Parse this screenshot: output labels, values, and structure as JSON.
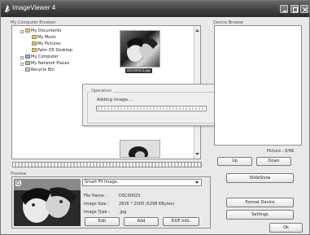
{
  "window": {
    "title": "ImageViewer 4"
  },
  "computer_browser": {
    "label": "My Computer Browser",
    "tree": [
      {
        "label": "My Documents",
        "icon": "folder-open-icon",
        "level": 0,
        "expand": "minus"
      },
      {
        "label": "My Music",
        "icon": "music-folder-icon",
        "level": 1
      },
      {
        "label": "My Pictures",
        "icon": "pictures-folder-icon",
        "level": 1
      },
      {
        "label": "Palm OS Desktop",
        "icon": "folder-icon",
        "level": 1
      },
      {
        "label": "My Computer",
        "icon": "computer-icon",
        "level": 0,
        "expand": "plus"
      },
      {
        "label": "My Network Places",
        "icon": "network-icon",
        "level": 0,
        "expand": "plus"
      },
      {
        "label": "Recycle Bin",
        "icon": "recycle-bin-icon",
        "level": 0
      }
    ],
    "selected_thumb_caption": "DSC00023.jpg"
  },
  "operation_dialog": {
    "group_label": "Operation",
    "message": "Adding image....",
    "progress": 0.0
  },
  "device_browser": {
    "label": "Device Browse",
    "picture_count": "Picture : 0/46",
    "up_label": "Up",
    "down_label": "Down"
  },
  "preview": {
    "label": "Preview",
    "fit_mode": "Smart Fit Image.",
    "file_name_label": "File Name :",
    "file_name": "DSC00023",
    "image_size_label": "Image Size :",
    "image_size": "2816 * 2000 (5298 KBytes)",
    "image_type_label": "Image Type :",
    "image_type": ".jpg",
    "edit_label": "Edit",
    "add_label": "Add",
    "exif_label": "EXIF Info."
  },
  "side_buttons": {
    "slideshow": "SlideShow",
    "format_device": "Format Device",
    "settings": "Settings",
    "ok": "Ok"
  },
  "colors": {
    "titlebar": "#3f3f3f",
    "panel_border": "#8e8e8e",
    "background": "#e9e9e9"
  }
}
